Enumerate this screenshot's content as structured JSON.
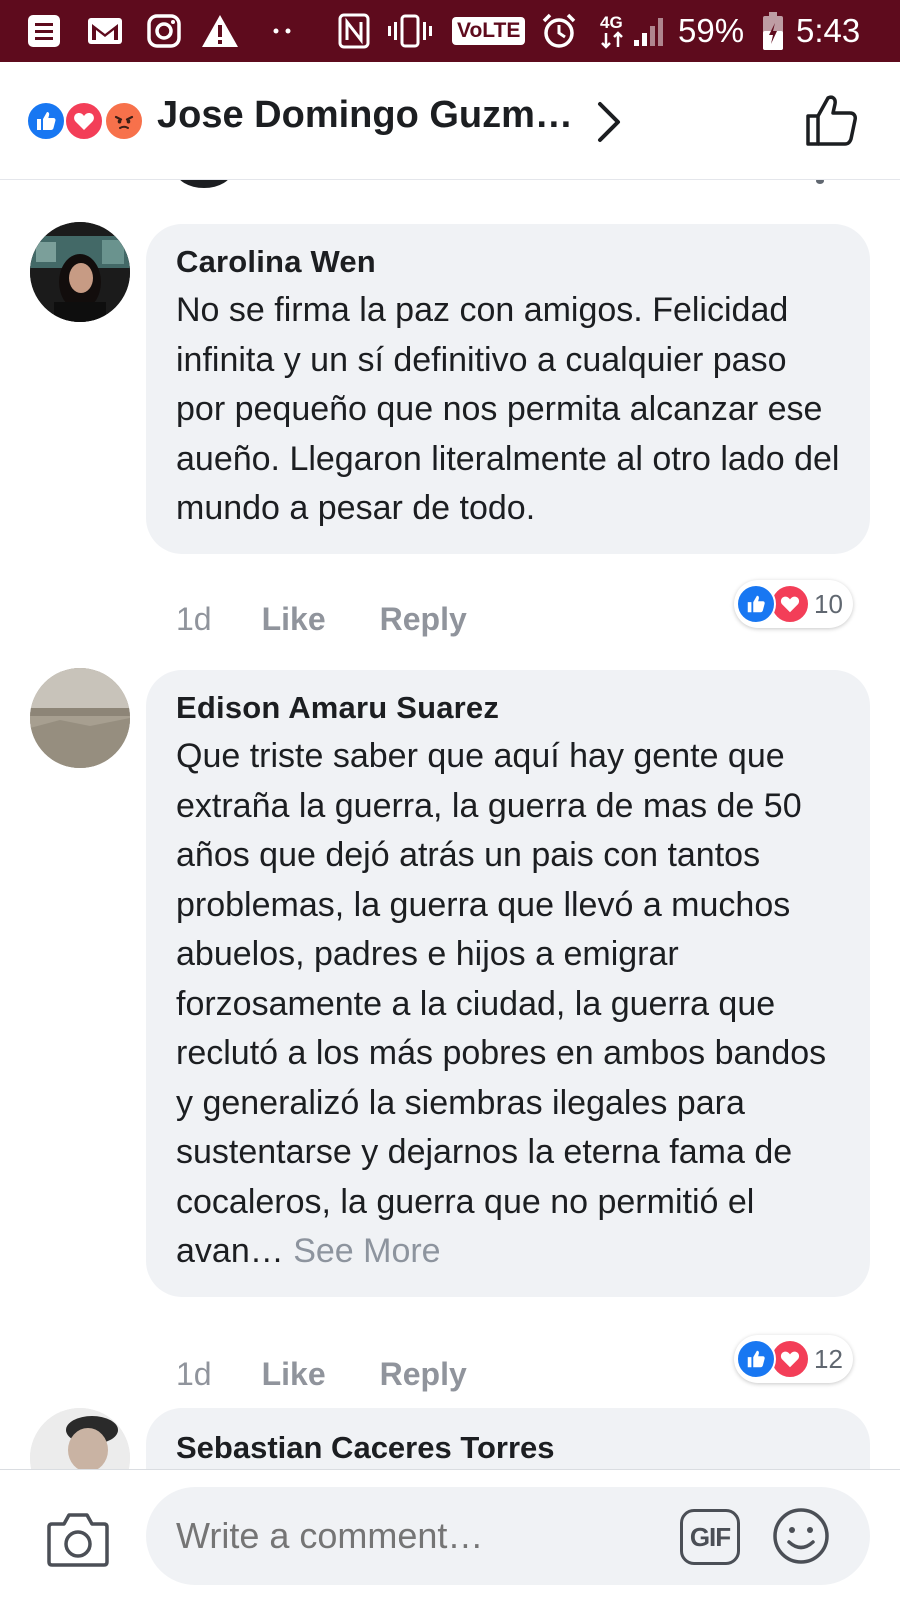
{
  "status_bar": {
    "battery": "59%",
    "time": "5:43",
    "volte": "VoLTE",
    "network": "4G",
    "icons": [
      "notes-icon",
      "gmail-icon",
      "instagram-icon",
      "warning-icon",
      "more-dots-icon",
      "nfc-icon",
      "vibrate-icon",
      "volte-icon",
      "alarm-icon",
      "network-4g-icon",
      "signal-icon",
      "battery-icon"
    ]
  },
  "header": {
    "reactions": [
      "like-reaction-icon",
      "love-reaction-icon",
      "angry-reaction-icon"
    ],
    "reactors_name": "Jose Domingo Guzm…"
  },
  "comments": [
    {
      "author": "Carolina Wen",
      "text": "No se firma la paz con amigos. Felicidad infinita y un sí definitivo a cualquier paso por pequeño que nos permita alcanzar ese aueño. Llegaron literalmente al otro lado del mundo a pesar de todo.",
      "time": "1d",
      "like_label": "Like",
      "reply_label": "Reply",
      "reactions": [
        "like-reaction-icon",
        "love-reaction-icon"
      ],
      "reaction_count": "10"
    },
    {
      "author": "Edison Amaru Suarez",
      "text": "Que triste saber que aquí hay gente que extraña la guerra, la guerra de mas de 50 años que dejó atrás un pais con tantos problemas, la guerra que llevó a muchos abuelos, padres e hijos a emigrar forzosamente a la ciudad, la guerra que reclutó a los más pobres en ambos bandos y generalizó la siembras ilegales para sustentarse y dejarnos la eterna fama de cocaleros, la guerra que no permitió el avan…",
      "see_more": "See More",
      "time": "1d",
      "like_label": "Like",
      "reply_label": "Reply",
      "reactions": [
        "like-reaction-icon",
        "love-reaction-icon"
      ],
      "reaction_count": "12"
    },
    {
      "author": "Sebastian Caceres Torres"
    }
  ],
  "composer": {
    "placeholder": "Write a comment…",
    "gif_label": "GIF"
  },
  "colors": {
    "status_bar": "#5e0b1d",
    "like_blue": "#1877f2",
    "love_red": "#f33e58",
    "angry_orange": "#f7714b",
    "bubble_gray": "#f0f2f5",
    "meta_gray": "#90949c"
  }
}
